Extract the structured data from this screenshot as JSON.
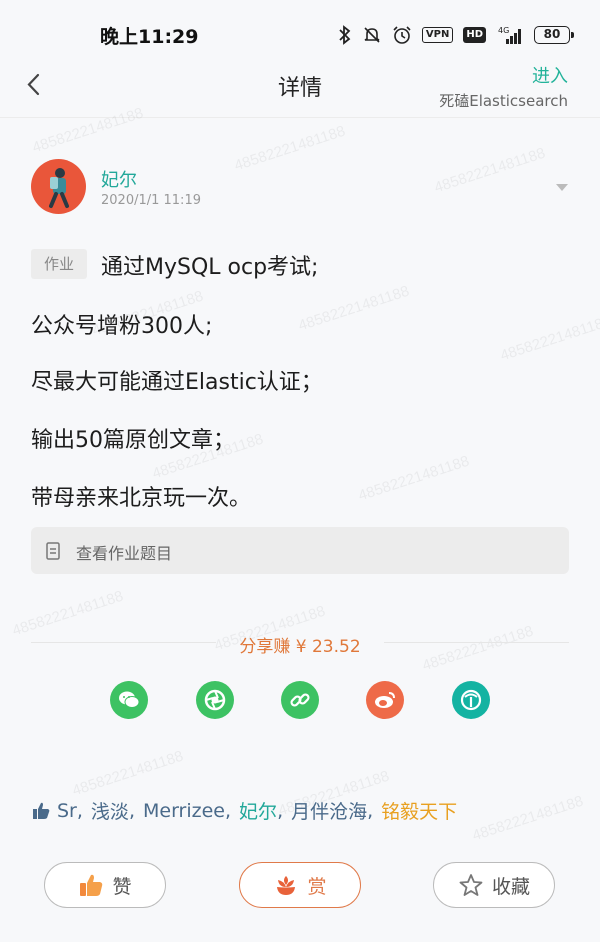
{
  "status_bar": {
    "time": "晚上11:29",
    "vpn": "VPN",
    "hd": "HD",
    "network": "4G",
    "battery": "80"
  },
  "nav": {
    "title": "详情",
    "enter": "进入",
    "subtitle": "死磕Elasticsearch"
  },
  "post": {
    "author": "妃尔",
    "date": "2020/1/1 11:19",
    "tag": "作业",
    "lines": [
      "通过MySQL  ocp考试;",
      "公众号增粉300人;",
      "尽最大可能通过Elastic认证；",
      "输出50篇原创文章；",
      "带母亲来北京玩一次。"
    ],
    "view_task": "查看作业题目"
  },
  "share": {
    "earn": "分享赚 ¥ 23.52",
    "icons": [
      {
        "name": "wechat-icon",
        "color": "#3dc263"
      },
      {
        "name": "moments-icon",
        "color": "#3dc263"
      },
      {
        "name": "link-icon",
        "color": "#3dc263"
      },
      {
        "name": "weibo-icon",
        "color": "#ee6a48"
      },
      {
        "name": "circle-icon",
        "color": "#14b3a2"
      }
    ]
  },
  "likes": {
    "users": [
      "Sr",
      "浅淡",
      "Merrizee",
      "妃尔",
      "月伴沧海",
      "铭毅天下"
    ],
    "separator": ","
  },
  "actions": {
    "like": "赞",
    "reward": "赏",
    "favorite": "收藏"
  },
  "watermark": "48582221481188"
}
